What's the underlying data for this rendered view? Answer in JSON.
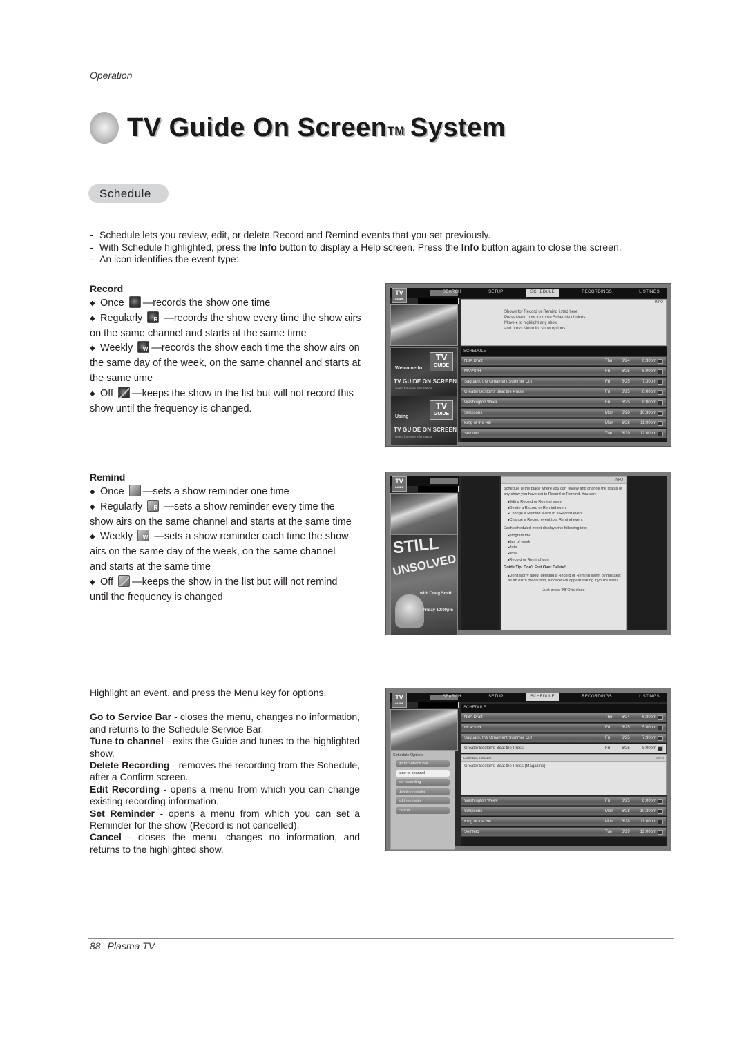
{
  "header": {
    "section": "Operation"
  },
  "title": {
    "main": "TV Guide On Screen",
    "tm": "TM",
    "suffix": "System"
  },
  "subsection": "Schedule",
  "intro": [
    "Schedule lets you review, edit, or delete Record and Remind events that you set previously.",
    {
      "pre": "With Schedule highlighted, press the ",
      "b1": "Info",
      "mid": " button to display a Help screen. Press the ",
      "b2": "Info",
      "post": " button again to close the screen."
    },
    "An icon identifies the event type:"
  ],
  "intro_line2_pre": "With Schedule highlighted, press the ",
  "intro_line2_b1": "Info",
  "intro_line2_mid": " button to display a Help screen. Press the ",
  "intro_line2_b2": "Info",
  "intro_line2_post": " button again to close the screen.",
  "record": {
    "heading": "Record",
    "items": [
      {
        "label": "Once",
        "icon": "record-once-icon",
        "desc": "—records the show one time"
      },
      {
        "label": "Regularly",
        "icon": "record-regularly-icon",
        "icon_letter": "R",
        "desc": "—records the show every time the show airs on the same channel and starts at the same time"
      },
      {
        "label": "Weekly",
        "icon": "record-weekly-icon",
        "icon_letter": "W",
        "desc": "—records the show each time the show airs on the same day of the week, on the same channel and starts at the same time"
      },
      {
        "label": "Off",
        "icon": "record-off-icon",
        "desc": "—keeps the show in the list but will not record this show until the frequency is changed."
      }
    ]
  },
  "remind": {
    "heading": "Remind",
    "items": [
      {
        "label": "Once",
        "icon": "remind-once-icon",
        "desc": "—sets a show reminder one time"
      },
      {
        "label": "Regularly",
        "icon": "remind-regularly-icon",
        "icon_letter": "R",
        "desc": "—sets a show reminder every time the show airs on the same channel and starts at the same time"
      },
      {
        "label": "Weekly",
        "icon": "remind-weekly-icon",
        "icon_letter": "W",
        "desc": "—sets a show reminder each time the show airs on the same day of the week, on the same channel and starts at the same time"
      },
      {
        "label": "Off",
        "icon": "remind-off-icon",
        "desc": "—keeps the show in the list but will not remind until the frequency is changed"
      }
    ]
  },
  "menu_help": {
    "intro": "Highlight an event, and press the Menu key for options.",
    "items": [
      {
        "term": "Go to Service Bar",
        "desc": " - closes the menu, changes no information, and returns to the Schedule Service Bar."
      },
      {
        "term": "Tune to channel",
        "desc": " - exits the Guide and tunes to the highlighted show."
      },
      {
        "term": "Delete Recording",
        "desc": " - removes the recording from the Schedule, after a Confirm screen."
      },
      {
        "term": "Edit Recording",
        "desc": " - opens a menu from which you can change existing recording information."
      },
      {
        "term": "Set Reminder",
        "desc": " - opens a menu from which you can set a Reminder for the show (Record is not cancelled)."
      },
      {
        "term": "Cancel",
        "desc": " - closes the menu, changes no information, and returns to the highlighted show."
      }
    ]
  },
  "screens": {
    "logo": "TV",
    "logo_sub": "GUIDE",
    "tabs": [
      "SEARCH",
      "SETUP",
      "SCHEDULE",
      "RECORDINGS",
      "LISTINGS"
    ],
    "active_tab": "SCHEDULE",
    "info_label": "INFO",
    "schedule_header": "SCHEDULE",
    "help_text": [
      "Shows for Record or Remind listed here",
      "Press Menu now for more Schedule choices",
      "Move ♦ to highlight any show",
      "and press Menu for show options"
    ],
    "ad1": {
      "logo": "TV",
      "logo_sub": "GUIDE",
      "line1": "Welcome to",
      "line2": "TV GUIDE ON SCREEN",
      "line3": "select for more information"
    },
    "ad2": {
      "logo": "TV",
      "logo_sub": "GUIDE",
      "line1": "Using",
      "line2": "TV GUIDE ON SCREEN",
      "line3": "select for more information"
    },
    "rows": [
      {
        "title": "NBA Draft",
        "day": "Thu",
        "date": "6/24",
        "time": "6:30pm"
      },
      {
        "title": "M*A*S*H",
        "day": "Fri",
        "date": "6/25",
        "time": "5:00pm"
      },
      {
        "title": "Saguaro, the Ornament Summer Cut",
        "day": "Fri",
        "date": "6/25",
        "time": "7:30pm"
      },
      {
        "title": "Greater Boston's Beat the Press",
        "day": "Fri",
        "date": "6/25",
        "time": "8:00pm"
      },
      {
        "title": "Washington Week",
        "day": "Fri",
        "date": "6/25",
        "time": "8:00pm"
      },
      {
        "title": "Simpsons",
        "day": "Mon",
        "date": "6/28",
        "time": "10:30pm"
      },
      {
        "title": "King of the Hill",
        "day": "Mon",
        "date": "6/28",
        "time": "11:00pm"
      },
      {
        "title": "Seinfeld",
        "day": "Tue",
        "date": "6/29",
        "time": "12:00pm"
      }
    ],
    "help2": {
      "intro": "Schedule is the place where you can review and change the status of any show you have set to Record or Remind. You can:",
      "can": [
        "Edit a Record or Remind event",
        "Delete a Record or Remind event",
        "Change a Remind event to a Record event",
        "Change a Record event to a Remind event"
      ],
      "each": "Each scheduled event displays the following info:",
      "info": [
        "program title",
        "day of week",
        "date",
        "time",
        "Record or Remind icon"
      ],
      "tip_head": "Guide Tip: Don't Fret Over Delete!",
      "tip": [
        "Don't worry about deleting a Record or Remind event by mistake: as an extra precaution, a notice will appear asking if you're sure!"
      ],
      "close": "Just press INFO to close"
    },
    "poster": {
      "line1": "STILL",
      "line2": "UNSOLVED",
      "by": "with Craig Smith",
      "when": "Friday 10:00pm"
    },
    "options": {
      "heading": "Schedule Options",
      "items": [
        "go to Service Bar",
        "tune to channel",
        "set recording",
        "delete reminder",
        "edit reminder",
        "cancel"
      ],
      "selected_index": 1
    },
    "detail": {
      "channel": "Cable Box 2 WGBH",
      "info": "INFO",
      "desc": "Greater Boston's Beat the Press (Magazine)"
    }
  },
  "footer": {
    "page": "88",
    "product": "Plasma TV"
  }
}
